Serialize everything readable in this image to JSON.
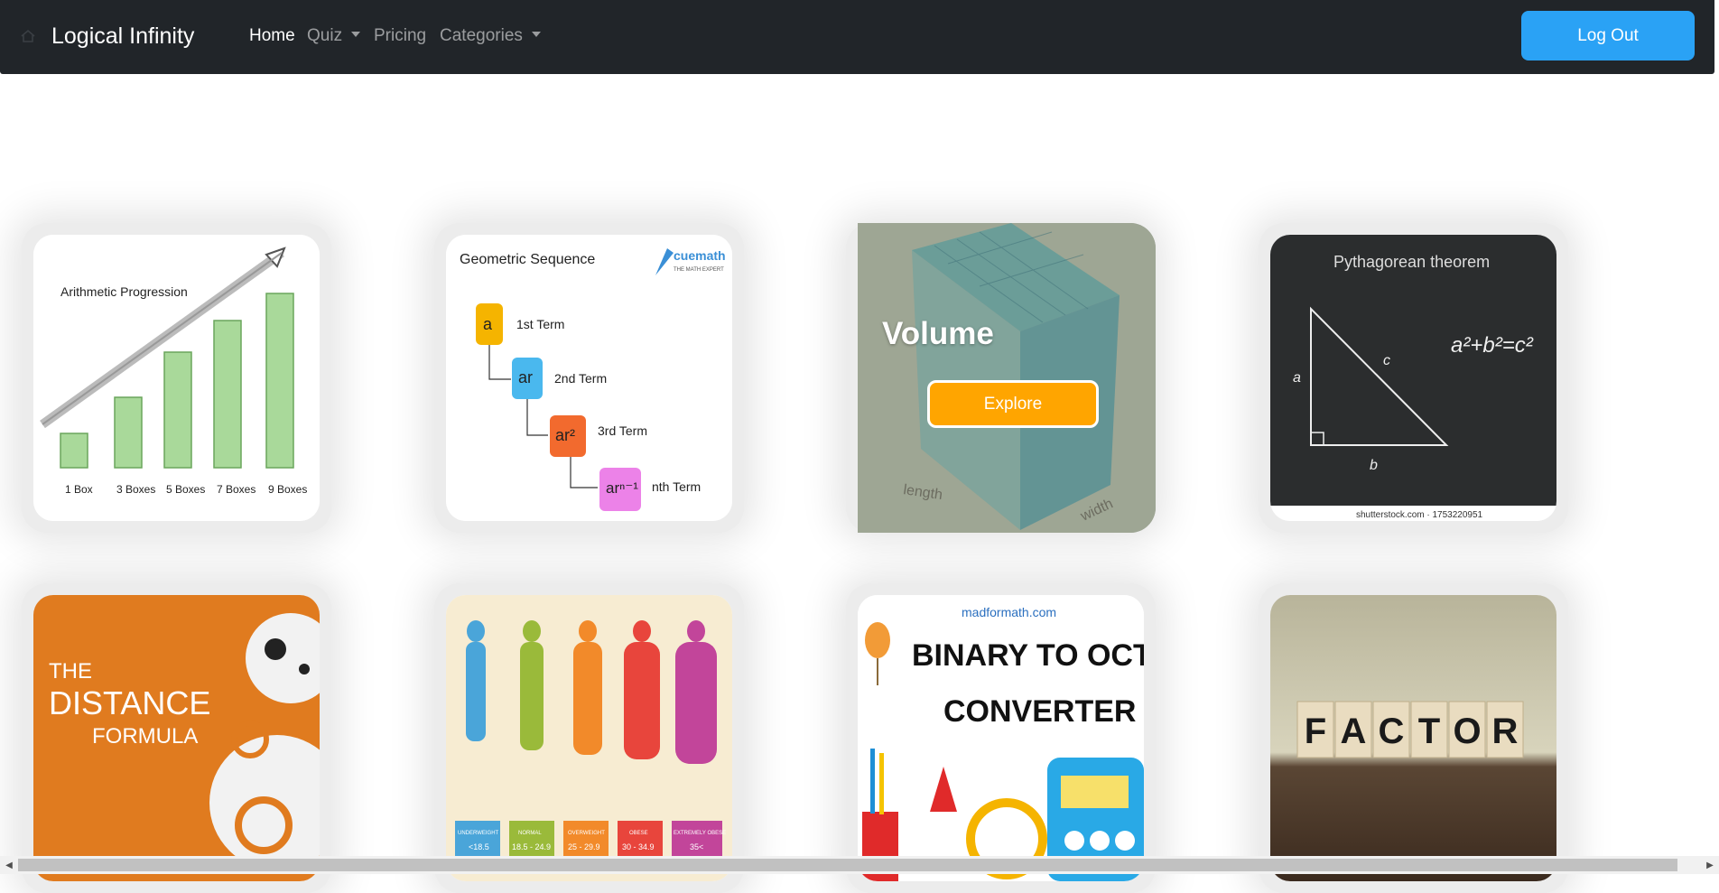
{
  "navbar": {
    "brand": "Logical Infinity",
    "links": [
      {
        "label": "Home"
      },
      {
        "label": "Quiz"
      },
      {
        "label": "Pricing"
      },
      {
        "label": "Categories"
      }
    ],
    "logout_label": "Log Out"
  },
  "cards": {
    "arithmetic": {
      "title": "Arithmetic Progression",
      "labels": [
        "1 Box",
        "3 Boxes",
        "5 Boxes",
        "7 Boxes",
        "9 Boxes"
      ]
    },
    "geometric": {
      "title": "Geometric Sequence",
      "brand": "cuemath",
      "brand_tag": "THE MATH EXPERT",
      "terms": [
        "a",
        "ar",
        "ar²",
        "arⁿ⁻¹"
      ],
      "term_labels": [
        "1st Term",
        "2nd Term",
        "3rd Term",
        "nth Term"
      ]
    },
    "volume": {
      "title": "Volume",
      "button": "Explore",
      "axis_labels": [
        "length",
        "width"
      ]
    },
    "pythagorean": {
      "title": "Pythagorean theorem",
      "formula": "a²+b²=c²",
      "sides": [
        "a",
        "b",
        "c"
      ],
      "credit": "shutterstock.com · 1753220951"
    },
    "distance": {
      "line1": "THE",
      "line2": "DISTANCE",
      "line3": "FORMULA"
    },
    "bmi": {
      "categories": [
        "UNDERWEIGHT",
        "NORMAL",
        "OVERWEIGHT",
        "OBESE",
        "EXTREMELY OBESE"
      ],
      "ranges": [
        "<18.5",
        "18.5 - 24.9",
        "25 - 29.9",
        "30 - 34.9",
        "35<"
      ]
    },
    "binary": {
      "site": "madformath.com",
      "line1": "BINARY TO OCTAL",
      "line2": "CONVERTER"
    },
    "factor": {
      "letters": [
        "F",
        "A",
        "C",
        "T",
        "O",
        "R"
      ]
    }
  },
  "colors": {
    "navbar_bg": "#212529",
    "logout_bg": "#2aa2f5",
    "explore_bg": "#ffa500"
  }
}
